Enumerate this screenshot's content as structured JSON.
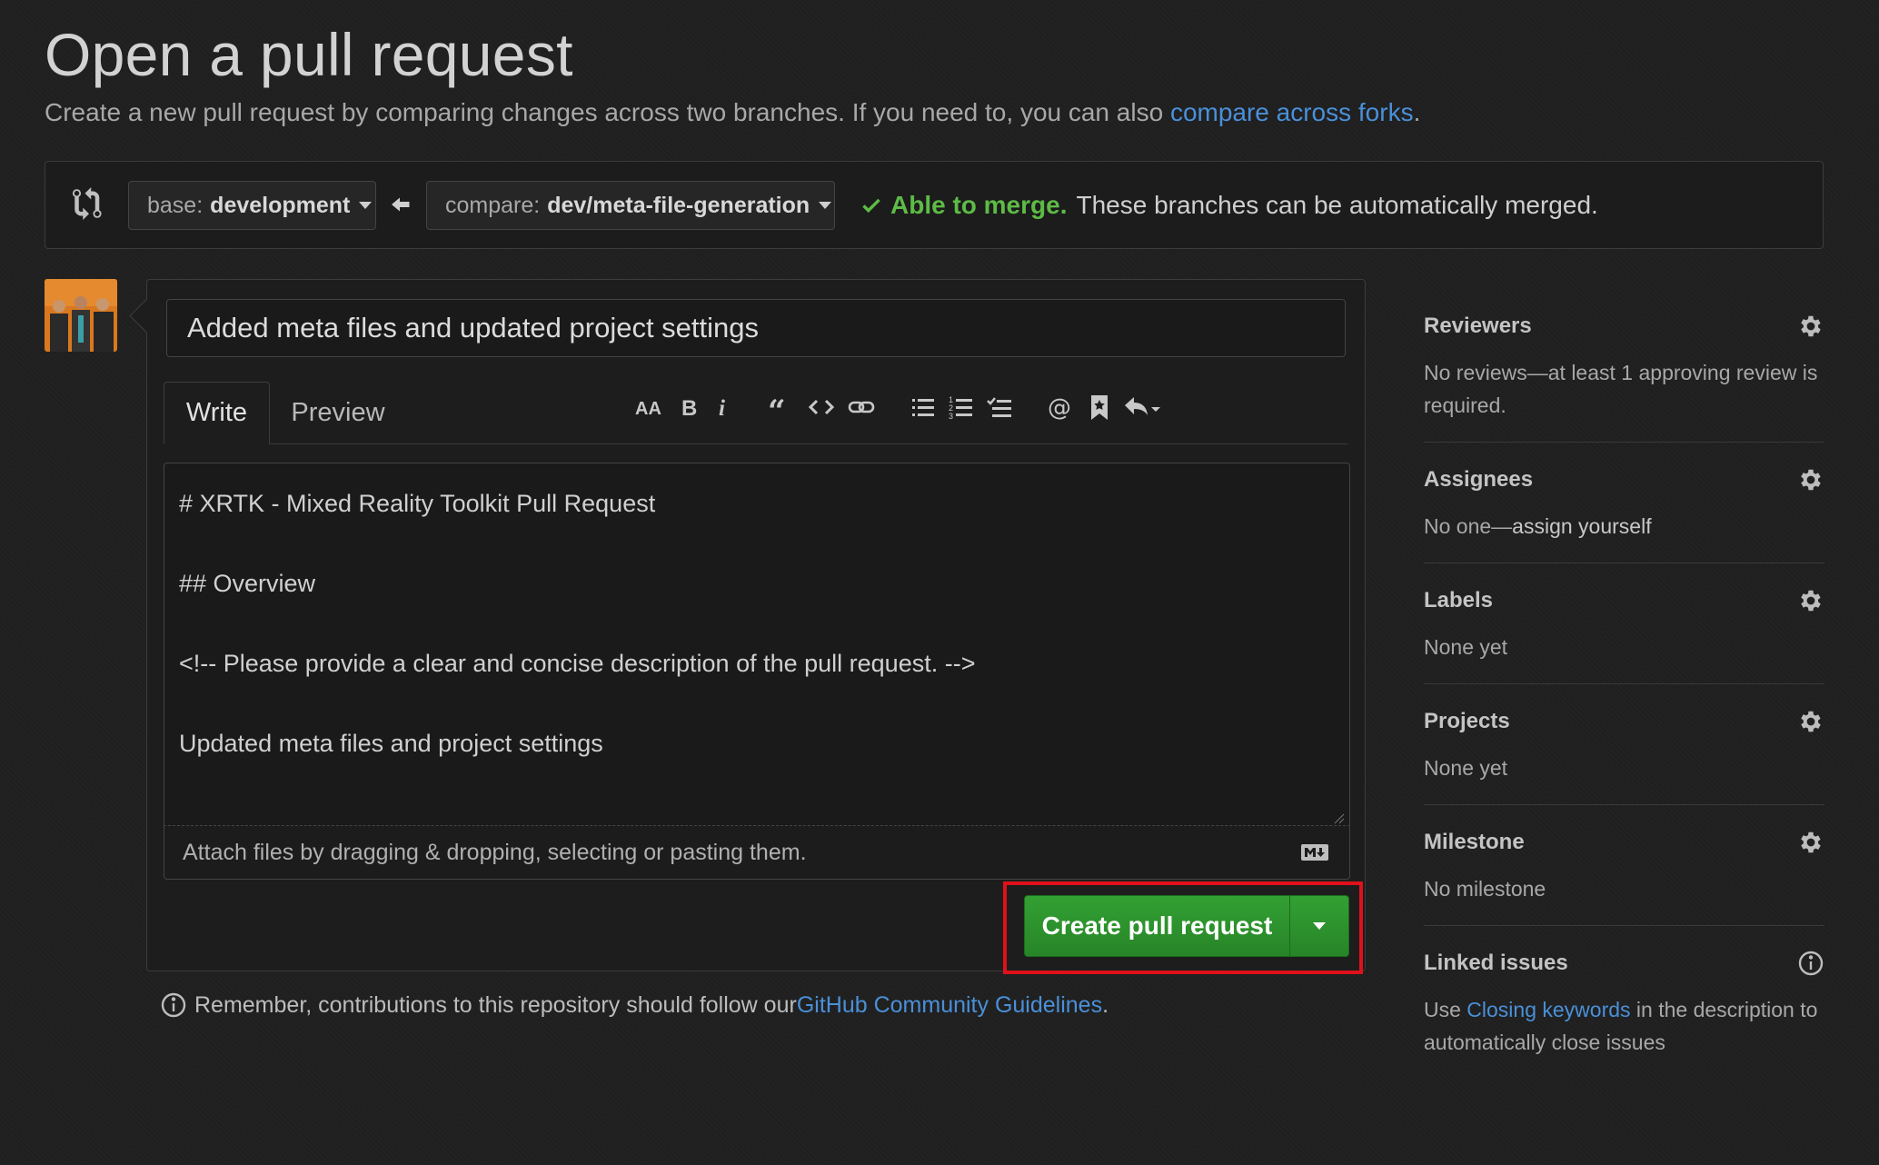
{
  "header": {
    "title": "Open a pull request",
    "subtitle_text": "Create a new pull request by comparing changes across two branches. If you need to, you can also ",
    "subtitle_link": "compare across forks",
    "subtitle_end": "."
  },
  "range": {
    "base_prefix": "base:",
    "base_branch": "development",
    "compare_prefix": "compare:",
    "compare_branch": "dev/meta-file-generation",
    "merge_ok": "Able to merge.",
    "merge_text": "These branches can be automatically merged."
  },
  "editor": {
    "title_value": "Added meta files and updated project settings",
    "tab_write": "Write",
    "tab_preview": "Preview",
    "body_value": "# XRTK - Mixed Reality Toolkit Pull Request\n\n## Overview\n\n<!-- Please provide a clear and concise description of the pull request. -->\n\nUpdated meta files and project settings",
    "attach_text": "Attach files by dragging & dropping, selecting or pasting them.",
    "toolbar_icons": [
      "text-size-icon",
      "bold-icon",
      "italic-icon",
      "quote-icon",
      "code-icon",
      "link-icon",
      "unordered-list-icon",
      "ordered-list-icon",
      "task-list-icon",
      "mention-icon",
      "saved-reply-icon",
      "reply-icon"
    ],
    "markdown_icon": "markdown-icon"
  },
  "actions": {
    "create_label": "Create pull request"
  },
  "guidelines": {
    "text": "Remember, contributions to this repository should follow our ",
    "link": "GitHub Community Guidelines",
    "end": "."
  },
  "sidebar": {
    "reviewers": {
      "title": "Reviewers",
      "body": "No reviews—at least 1 approving review is required."
    },
    "assignees": {
      "title": "Assignees",
      "body_prefix": "No one—",
      "body_link": "assign yourself"
    },
    "labels": {
      "title": "Labels",
      "body": "None yet"
    },
    "projects": {
      "title": "Projects",
      "body": "None yet"
    },
    "milestone": {
      "title": "Milestone",
      "body": "No milestone"
    },
    "linked": {
      "title": "Linked issues",
      "body_prefix": "Use ",
      "body_link": "Closing keywords",
      "body_suffix": " in the description to automatically close issues"
    }
  },
  "colors": {
    "accent_link": "#4a90d9",
    "merge_ok": "#5dbb46",
    "primary_button": "#2b8a2b",
    "highlight": "#e0111a"
  }
}
